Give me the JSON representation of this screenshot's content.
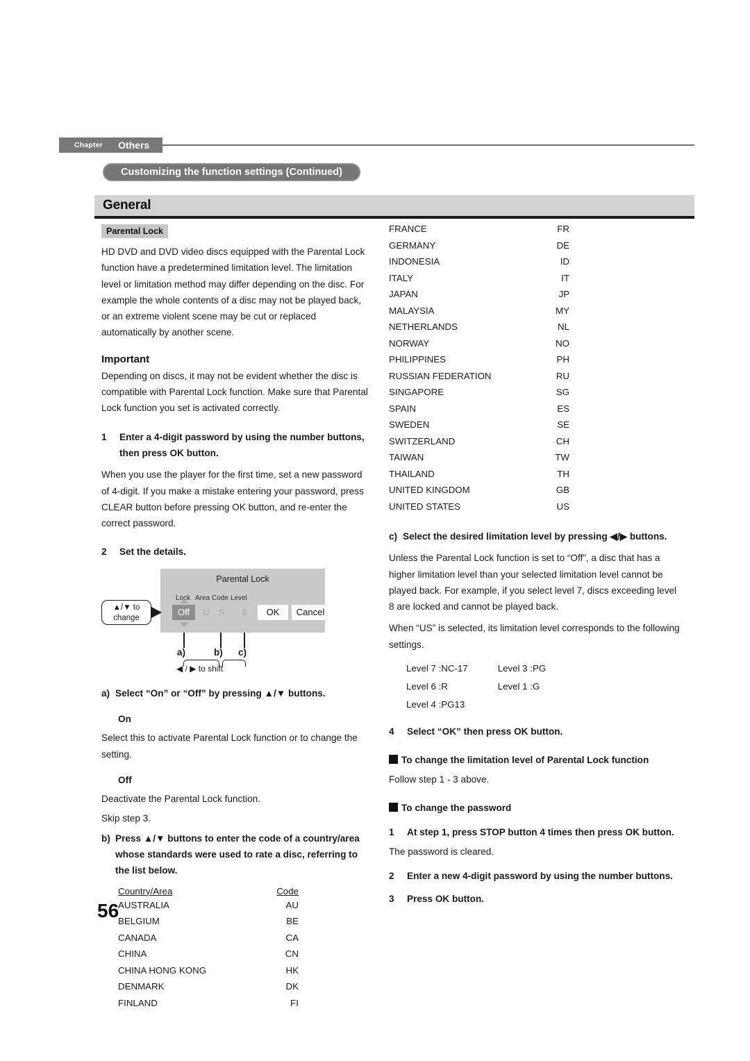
{
  "header": {
    "chapter_word": "Chapter",
    "chapter_name": "Others",
    "continued_title": "Customizing the function settings (Continued)",
    "section_banner": "General"
  },
  "left_column": {
    "section_label": "Parental Lock",
    "intro": "HD DVD and DVD video discs equipped with the Parental Lock function have a predetermined limitation level. The limitation level or limitation method may differ depending on the disc. For example the whole contents of a disc may not be played back, or an extreme violent scene may be cut or replaced automatically by another scene.",
    "important_heading": "Important",
    "important_body": "Depending on discs, it may not be evident whether the disc is compatible with Parental Lock function. Make sure that Parental Lock function you set is activated correctly.",
    "step1": {
      "number": "1",
      "title": "Enter a 4-digit password by using the number buttons, then press OK button.",
      "body": "When you use the player for the first time, set a new password of 4-digit. If you make a mistake entering your password, press CLEAR button before pressing OK button, and re-enter the correct password."
    },
    "step2": {
      "number": "2",
      "title": "Set the details."
    },
    "figure": {
      "title": "Parental Lock",
      "label_lock": "Lock",
      "label_area_code": "Area Code",
      "label_level": "Level",
      "value_lock": "Off",
      "value_area_1": "U",
      "value_area_2": "S",
      "value_level": "8",
      "button_ok": "OK",
      "button_cancel": "Cancel",
      "callout_change": "▲/▼ to change",
      "marker_a": "a)",
      "marker_b": "b)",
      "marker_c": "c)",
      "shift_label": "◀ / ▶ to shift"
    },
    "item_a": {
      "mark": "a)",
      "title": "Select “On” or “Off” by pressing ▲/▼ buttons.",
      "on_heading": "On",
      "on_body": "Select this to activate Parental Lock function or to change the setting.",
      "off_heading": "Off",
      "off_body_1": "Deactivate the Parental Lock function.",
      "off_body_2": "Skip step 3."
    },
    "item_b": {
      "mark": "b)",
      "title": "Press ▲/▼ buttons to enter the code of a country/area whose standards were used to rate a disc, referring to the list below."
    },
    "country_table": {
      "header_country": "Country/Area",
      "header_code": "Code",
      "rows": [
        {
          "country": "AUSTRALIA",
          "code": "AU"
        },
        {
          "country": "BELGIUM",
          "code": "BE"
        },
        {
          "country": "CANADA",
          "code": "CA"
        },
        {
          "country": "CHINA",
          "code": "CN"
        },
        {
          "country": "CHINA HONG KONG",
          "code": "HK"
        },
        {
          "country": "DENMARK",
          "code": "DK"
        },
        {
          "country": "FINLAND",
          "code": "FI"
        }
      ]
    }
  },
  "right_column": {
    "country_table_rows": [
      {
        "country": "FRANCE",
        "code": "FR"
      },
      {
        "country": "GERMANY",
        "code": "DE"
      },
      {
        "country": "INDONESIA",
        "code": "ID"
      },
      {
        "country": "ITALY",
        "code": "IT"
      },
      {
        "country": "JAPAN",
        "code": "JP"
      },
      {
        "country": "MALAYSIA",
        "code": "MY"
      },
      {
        "country": "NETHERLANDS",
        "code": "NL"
      },
      {
        "country": "NORWAY",
        "code": "NO"
      },
      {
        "country": "PHILIPPINES",
        "code": "PH"
      },
      {
        "country": "RUSSIAN FEDERATION",
        "code": "RU"
      },
      {
        "country": "SINGAPORE",
        "code": "SG"
      },
      {
        "country": "SPAIN",
        "code": "ES"
      },
      {
        "country": "SWEDEN",
        "code": "SE"
      },
      {
        "country": "SWITZERLAND",
        "code": "CH"
      },
      {
        "country": "TAIWAN",
        "code": "TW"
      },
      {
        "country": "THAILAND",
        "code": "TH"
      },
      {
        "country": "UNITED KINGDOM",
        "code": "GB"
      },
      {
        "country": "UNITED STATES",
        "code": "US"
      }
    ],
    "item_c": {
      "mark": "c)",
      "title": "Select the desired limitation level by pressing ◀/▶ buttons.",
      "body_1": "Unless the Parental Lock function is set to “Off”, a disc that has a higher limitation level than your selected limitation level cannot be played back. For example, if you select level 7, discs exceeding level 8 are locked and cannot be played back.",
      "body_2": "When “US” is selected, its limitation level corresponds to the following settings."
    },
    "levels": [
      {
        "left": "Level 7 :NC-17",
        "right": "Level 3 :PG"
      },
      {
        "left": "Level 6 :R",
        "right": "Level 1 :G"
      },
      {
        "left": "Level 4 :PG13",
        "right": ""
      }
    ],
    "step4": {
      "number": "4",
      "title": "Select “OK” then press OK button."
    },
    "change_limit": {
      "heading": "To change the limitation level of Parental Lock function",
      "body": "Follow step 1 - 3 above."
    },
    "change_password": {
      "heading": "To change the password",
      "step1": {
        "number": "1",
        "title": "At step 1, press STOP button 4 times then press OK button.",
        "body": "The password is cleared."
      },
      "step2": {
        "number": "2",
        "title": "Enter a new 4-digit password by using the number buttons."
      },
      "step3": {
        "number": "3",
        "title": "Press OK button."
      }
    }
  },
  "footer": {
    "page_number": "56"
  }
}
